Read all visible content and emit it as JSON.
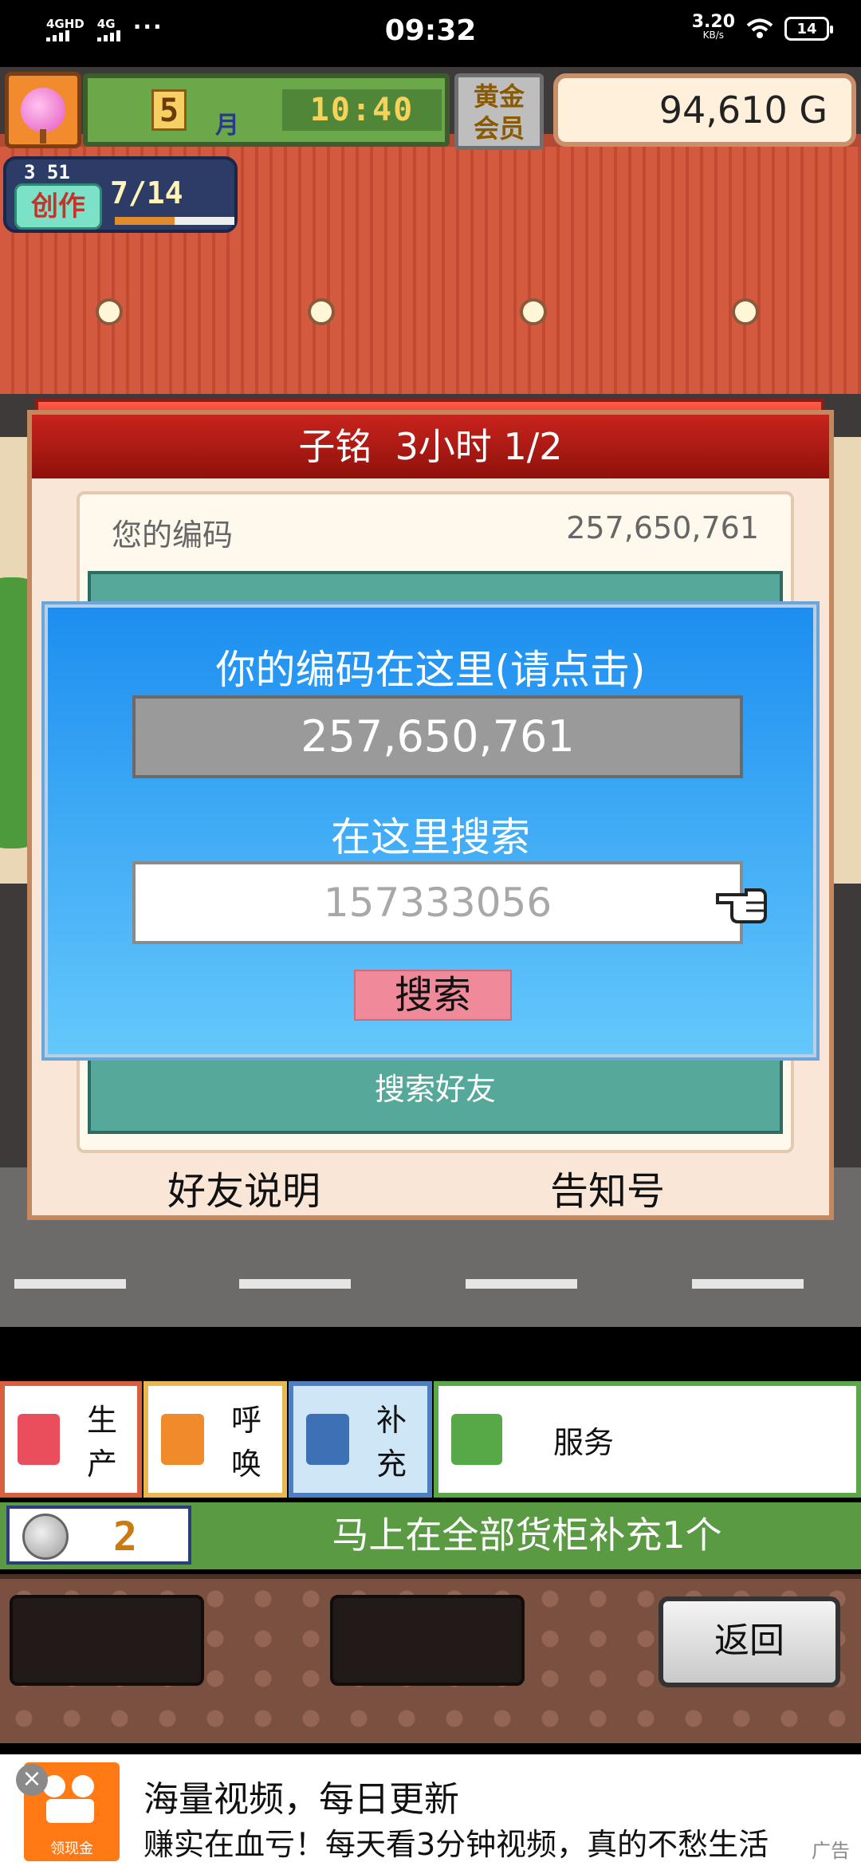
{
  "status_bar": {
    "network1": "4GHD",
    "network2": "4G",
    "dots": "···",
    "time": "09:32",
    "speed_value": "3.20",
    "speed_unit": "KB/s",
    "battery": "14"
  },
  "hud": {
    "month_number": "5",
    "month_label": "月",
    "clock": "10:40",
    "gold_member": "黄金\n会员",
    "money": "94,610 G",
    "create_level": "3 51",
    "create_label": "创作",
    "create_value": "7/14",
    "create_progress": 0.5
  },
  "friend_panel": {
    "title": "子铭  3小时 1/2",
    "your_code_label": "您的编码",
    "your_code_value": "257,650,761",
    "search_friend_label": "搜索好友",
    "friend_help": "好友说明",
    "notice_number": "告知号"
  },
  "popup": {
    "title": "你的编码在这里(请点击)",
    "code": "257,650,761",
    "search_label": "在这里搜索",
    "search_placeholder": "157333056",
    "search_button": "搜索"
  },
  "menu": {
    "tabs": [
      {
        "label": "生产",
        "icon": "food-icon"
      },
      {
        "label": "呼唤",
        "icon": "megaphone-icon"
      },
      {
        "label": "补充",
        "icon": "cake-icon"
      },
      {
        "label": "服务",
        "icon": "teacup-icon"
      }
    ],
    "ticket_count": "2",
    "info_text": "马上在全部货柜补充1个",
    "back_button": "返回"
  },
  "ad": {
    "close": "×",
    "logo_sub": "领现金",
    "title": "海量视频，每日更新",
    "subtitle": "赚实在血亏！每天看3分钟视频，真的不愁生活",
    "tag": "广告"
  }
}
